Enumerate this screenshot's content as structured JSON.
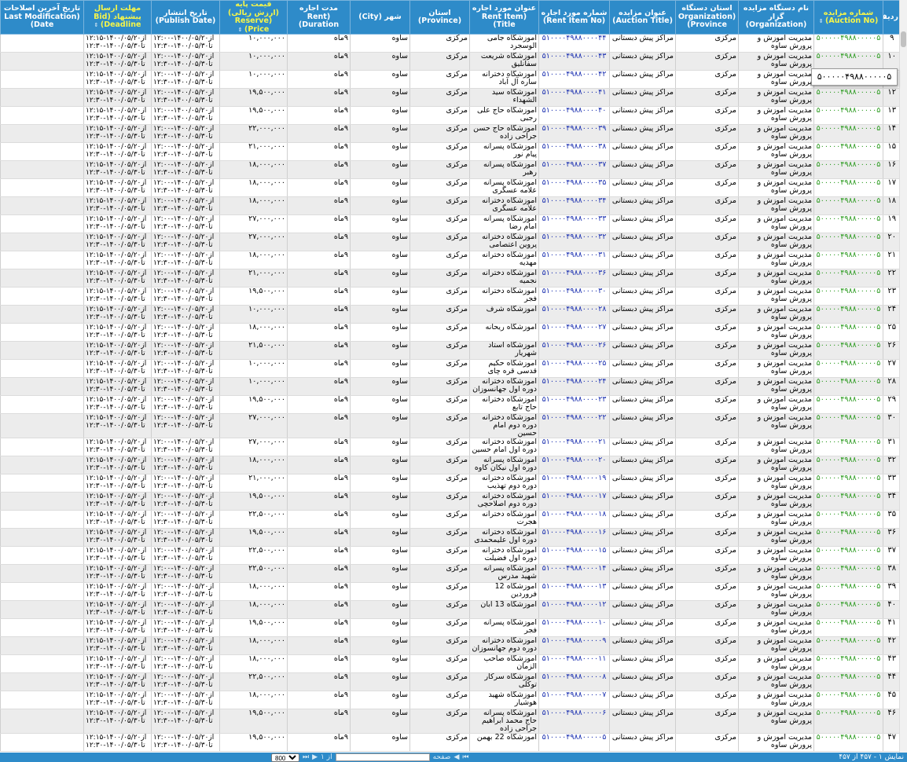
{
  "columns": [
    {
      "label": "ردیف",
      "sortable": false
    },
    {
      "label": "شماره مزایده (Auction No)",
      "sortable": true
    },
    {
      "label": "نام دستگاه مزایده گزار (Organization)",
      "sortable": false
    },
    {
      "label": "استان دستگاه (Organization Province)",
      "sortable": false
    },
    {
      "label": "عنوان مزایده (Auction Title)",
      "sortable": false
    },
    {
      "label": "شماره مورد اجاره (Rent Item No)",
      "sortable": false
    },
    {
      "label": "عنوان مورد اجاره (Rent Item Title)",
      "sortable": false
    },
    {
      "label": "استان (Province)",
      "sortable": false
    },
    {
      "label": "شهر (City)",
      "sortable": false
    },
    {
      "label": "مدت اجاره (Rent Duration)",
      "sortable": false
    },
    {
      "label": "قیمت پایه (ارزش ریالی) (Reserve Price)",
      "sortable": true
    },
    {
      "label": "تاریخ انتشار (Publish Date)",
      "sortable": false
    },
    {
      "label": "مهلت ارسال پیشنهاد (Bid Deadline)",
      "sortable": true
    },
    {
      "label": "تاریخ آخرین اصلاحات (Last Modification Date)",
      "sortable": false
    }
  ],
  "common": {
    "org": "مدیریت آموزش و پرورش ساوه",
    "org_province": "مرکزی",
    "auction_title": "مراکز پیش دبستانی",
    "province": "مرکزی",
    "city": "ساوه",
    "duration": "۹ماه",
    "publish_date": "از۱۴۰۰/۰۵/۲۰-۱۲:۰۰ تا۱۴۰۰/۰۵/۳۰-۱۲:۳۰",
    "deadline": "از۱۴۰۰/۰۵/۲۰-۱۲:۱۵ تا۱۴۰۰/۰۵/۳۰-۱۲:۳۰",
    "auction_no": "۵۰۰۰۰۰۴۹۸۸۰۰۰۰۰۵"
  },
  "rows": [
    {
      "no": "۹",
      "item_no": "۵۱۰۰۰۰۴۹۸۸۰۰۰۰۴۴",
      "title": "آموزشگاه جامی الوسجرد",
      "price": "۱۰,۰۰۰,۰۰۰"
    },
    {
      "no": "۱۰",
      "item_no": "۵۱۰۰۰۰۴۹۸۸۰۰۰۰۴۳",
      "title": "آموزشگاه شریعت سفانلیق",
      "price": "۱۰,۰۰۰,۰۰۰"
    },
    {
      "no": "۱۱",
      "item_no": "۵۱۰۰۰۰۴۹۸۸۰۰۰۰۴۲",
      "title": "آموزشگاه دخترانه ساره آل آباد",
      "price": "۱۰,۰۰۰,۰۰۰"
    },
    {
      "no": "۱۲",
      "item_no": "۵۱۰۰۰۰۴۹۸۸۰۰۰۰۴۱",
      "title": "آموزشگاه سید الشهداء",
      "price": "۱۹,۵۰۰,۰۰۰"
    },
    {
      "no": "۱۳",
      "item_no": "۵۱۰۰۰۰۴۹۸۸۰۰۰۰۴۰",
      "title": "آموزشگاه حاج علی رجبی",
      "price": "۱۹,۵۰۰,۰۰۰"
    },
    {
      "no": "۱۴",
      "item_no": "۵۱۰۰۰۰۴۹۸۸۰۰۰۰۳۹",
      "title": "آموزشگاه حاج حسن جراحی زاده",
      "price": "۲۲,۰۰۰,۰۰۰"
    },
    {
      "no": "۱۵",
      "item_no": "۵۱۰۰۰۰۴۹۸۸۰۰۰۰۳۸",
      "title": "آموزشگاه پسرانه پیام نور",
      "price": "۲۱,۰۰۰,۰۰۰"
    },
    {
      "no": "۱۶",
      "item_no": "۵۱۰۰۰۰۴۹۸۸۰۰۰۰۳۷",
      "title": "آموزشگاه پسرانه رهبر",
      "price": "۱۸,۰۰۰,۰۰۰"
    },
    {
      "no": "۱۷",
      "item_no": "۵۱۰۰۰۰۴۹۸۸۰۰۰۰۳۵",
      "title": "آموزشگاه پسرانه علامه عسگری",
      "price": "۱۸,۰۰۰,۰۰۰"
    },
    {
      "no": "۱۸",
      "item_no": "۵۱۰۰۰۰۴۹۸۸۰۰۰۰۳۴",
      "title": "آموزشگاه دخترانه علامه عسگری",
      "price": "۱۸,۰۰۰,۰۰۰"
    },
    {
      "no": "۱۹",
      "item_no": "۵۱۰۰۰۰۴۹۸۸۰۰۰۰۳۳",
      "title": "آموزشگاه پسرانه امام رضا",
      "price": "۲۷,۰۰۰,۰۰۰"
    },
    {
      "no": "۲۰",
      "item_no": "۵۱۰۰۰۰۴۹۸۸۰۰۰۰۳۲",
      "title": "آموزشگاه دخترانه پروین اعتصامی",
      "price": "۲۷,۰۰۰,۰۰۰"
    },
    {
      "no": "۲۱",
      "item_no": "۵۱۰۰۰۰۴۹۸۸۰۰۰۰۳۱",
      "title": "آموزشگاه دخترانه مهدیه",
      "price": "۱۸,۰۰۰,۰۰۰"
    },
    {
      "no": "۲۲",
      "item_no": "۵۱۰۰۰۰۴۹۸۸۰۰۰۰۳۶",
      "title": "آموزشگاه دخترانه نجمیه",
      "price": "۲۱,۰۰۰,۰۰۰"
    },
    {
      "no": "۲۳",
      "item_no": "۵۱۰۰۰۰۴۹۸۸۰۰۰۰۳۰",
      "title": "آموزشگاه دخترانه فجر",
      "price": "۱۹,۵۰۰,۰۰۰"
    },
    {
      "no": "۲۴",
      "item_no": "۵۱۰۰۰۰۴۹۸۸۰۰۰۰۲۸",
      "title": "آموزشگاه شرف",
      "price": "۱۰,۰۰۰,۰۰۰"
    },
    {
      "no": "۲۵",
      "item_no": "۵۱۰۰۰۰۴۹۸۸۰۰۰۰۲۷",
      "title": "آموزشگاه ریحانه",
      "price": "۱۸,۰۰۰,۰۰۰"
    },
    {
      "no": "۲۶",
      "item_no": "۵۱۰۰۰۰۴۹۸۸۰۰۰۰۲۶",
      "title": "آموزشگاه استاد شهریار",
      "price": "۲۱,۵۰۰,۰۰۰"
    },
    {
      "no": "۲۷",
      "item_no": "۵۱۰۰۰۰۴۹۸۸۰۰۰۰۲۵",
      "title": "آموزشگاه حکیم قدسی قره چای",
      "price": "۱۰,۰۰۰,۰۰۰"
    },
    {
      "no": "۲۸",
      "item_no": "۵۱۰۰۰۰۴۹۸۸۰۰۰۰۲۴",
      "title": "آموزشگاه دخترانه دوره اول جهانسوزان",
      "price": "۱۰,۰۰۰,۰۰۰"
    },
    {
      "no": "۲۹",
      "item_no": "۵۱۰۰۰۰۴۹۸۸۰۰۰۰۲۳",
      "title": "آموزشگاه دخترانه حاج تابع",
      "price": "۱۹,۵۰۰,۰۰۰"
    },
    {
      "no": "۳۰",
      "item_no": "۵۱۰۰۰۰۴۹۸۸۰۰۰۰۲۲",
      "title": "آموزشگاه دخترانه دوره دوم امام حسین",
      "price": "۲۷,۰۰۰,۰۰۰"
    },
    {
      "no": "۳۱",
      "item_no": "۵۱۰۰۰۰۴۹۸۸۰۰۰۰۲۱",
      "title": "آموزشگاه دخترانه دوره اول امام حسین",
      "price": "۲۷,۰۰۰,۰۰۰"
    },
    {
      "no": "۳۲",
      "item_no": "۵۱۰۰۰۰۴۹۸۸۰۰۰۰۲۰",
      "title": "آموزشگاه پسرانه دوره اول نیکان کاوه",
      "price": "۱۸,۰۰۰,۰۰۰"
    },
    {
      "no": "۳۳",
      "item_no": "۵۱۰۰۰۰۴۹۸۸۰۰۰۰۱۹",
      "title": "آموزشگاه دخترانه دوره دوم تهذیب",
      "price": "۲۱,۰۰۰,۰۰۰"
    },
    {
      "no": "۳۴",
      "item_no": "۵۱۰۰۰۰۴۹۸۸۰۰۰۰۱۷",
      "title": "آموزشگاه دخترانه دوره دوم اصلاحچی",
      "price": "۱۹,۵۰۰,۰۰۰"
    },
    {
      "no": "۳۵",
      "item_no": "۵۱۰۰۰۰۴۹۸۸۰۰۰۰۱۸",
      "title": "آموزشگاه دخترانه هجرت",
      "price": "۲۲,۵۰۰,۰۰۰"
    },
    {
      "no": "۳۶",
      "item_no": "۵۱۰۰۰۰۴۹۸۸۰۰۰۰۱۶",
      "title": "آموزشگاه دخترانه دوره اول علیمحمدی",
      "price": "۱۹,۵۰۰,۰۰۰"
    },
    {
      "no": "۳۷",
      "item_no": "۵۱۰۰۰۰۴۹۸۸۰۰۰۰۱۵",
      "title": "آموزشگاه دخترانه دوره اول فضیلت",
      "price": "۲۲,۵۰۰,۰۰۰"
    },
    {
      "no": "۳۸",
      "item_no": "۵۱۰۰۰۰۴۹۸۸۰۰۰۰۱۴",
      "title": "آموزشگاه پسرانه شهید مدرس",
      "price": "۲۲,۵۰۰,۰۰۰"
    },
    {
      "no": "۳۹",
      "item_no": "۵۱۰۰۰۰۴۹۸۸۰۰۰۰۱۳",
      "title": "آموزشگاه 12 فروردین",
      "price": "۱۸,۰۰۰,۰۰۰"
    },
    {
      "no": "۴۰",
      "item_no": "۵۱۰۰۰۰۴۹۸۸۰۰۰۰۱۲",
      "title": "آموزشگاه 13 آبان",
      "price": "۱۸,۰۰۰,۰۰۰"
    },
    {
      "no": "۴۱",
      "item_no": "۵۱۰۰۰۰۴۹۸۸۰۰۰۰۱۰",
      "title": "آموزشگاه پسرانه فجر",
      "price": "۱۹,۵۰۰,۰۰۰"
    },
    {
      "no": "۴۲",
      "item_no": "۵۱۰۰۰۰۴۹۸۸۰۰۰۰۰۹",
      "title": "آموزشگاه دخترانه دوره دوم جهانسوزان",
      "price": "۱۸,۰۰۰,۰۰۰"
    },
    {
      "no": "۴۳",
      "item_no": "۵۱۰۰۰۰۴۹۸۸۰۰۰۰۱۱",
      "title": "آموزشگاه صاحب الزمان",
      "price": "۱۸,۰۰۰,۰۰۰"
    },
    {
      "no": "۴۴",
      "item_no": "۵۱۰۰۰۰۴۹۸۸۰۰۰۰۰۸",
      "title": "آموزشگاه سرکار توکلی",
      "price": "۲۲,۵۰۰,۰۰۰"
    },
    {
      "no": "۴۵",
      "item_no": "۵۱۰۰۰۰۴۹۸۸۰۰۰۰۰۷",
      "title": "آموزشگاه شهید هوشیار",
      "price": "۱۸,۰۰۰,۰۰۰"
    },
    {
      "no": "۴۶",
      "item_no": "۵۱۰۰۰۰۴۹۸۸۰۰۰۰۰۶",
      "title": "آموزشگاه پسرانه حاج محمد ابراهیم جراحی زاده",
      "price": "۱۹,۵۰۰,۰۰۰"
    },
    {
      "no": "۴۷",
      "item_no": "۵۱۰۰۰۰۴۹۸۸۰۰۰۰۰۵",
      "title": "آموزشگاه 22 بهمن",
      "price": "۱۹,۵۰۰,۰۰۰"
    }
  ],
  "tooltip": "۵۰۰۰۰۰۴۹۸۸۰۰۰۰۰۵",
  "footer": {
    "info": "نمایش ۱ - ۴۵۷ از ۴۵۷",
    "page_label": "صفحه",
    "of_label": "از ۱",
    "page_size": "800",
    "first_icon": "first-page-icon",
    "prev_icon": "prev-page-icon",
    "next_icon": "next-page-icon",
    "last_icon": "last-page-icon"
  },
  "colors": {
    "header_bg": "#2e8bc9",
    "sortable_header": "#f5f54a",
    "auction_no": "#2a9a1e",
    "item_no": "#1a2fb0",
    "alt_row": "#ececec"
  }
}
